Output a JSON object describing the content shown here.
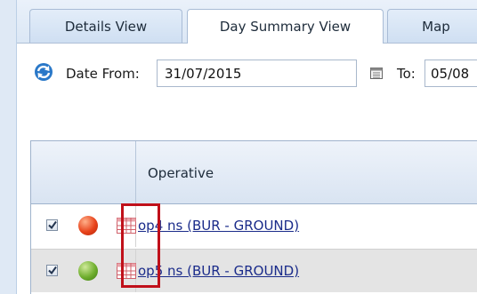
{
  "tabs": [
    {
      "label": "Details View",
      "active": false
    },
    {
      "label": "Day Summary View",
      "active": true
    },
    {
      "label": "Map",
      "active": false
    }
  ],
  "filter": {
    "date_from_label": "Date From:",
    "date_from_value": "31/07/2015",
    "to_label": "To:",
    "date_to_value": "05/08"
  },
  "grid": {
    "columns": [
      "",
      "Operative"
    ],
    "rows": [
      {
        "checked": true,
        "status_color": "#e8431b",
        "operative": "op4 ns (BUR - GROUND)"
      },
      {
        "checked": true,
        "status_color": "#6fae2e",
        "operative": "op5 ns (BUR - GROUND)"
      }
    ]
  },
  "colors": {
    "highlight": "#c0101a",
    "link": "#1a2b8a",
    "tab_bar": "#dbe7f5"
  }
}
